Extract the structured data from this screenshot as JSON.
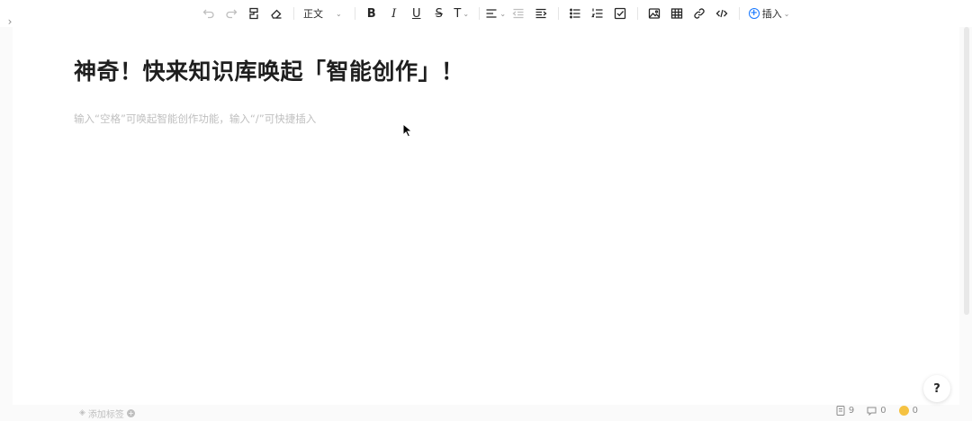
{
  "toolbar": {
    "style_label": "正文",
    "insert_label": "插入",
    "icons": [
      "undo-icon",
      "redo-icon",
      "format-painter-icon",
      "eraser-icon",
      "bold-icon",
      "italic-icon",
      "underline-icon",
      "strikethrough-icon",
      "font-size-icon",
      "align-icon",
      "outdent-icon",
      "indent-icon",
      "bullet-list-icon",
      "ordered-list-icon",
      "checklist-icon",
      "image-icon",
      "table-icon",
      "link-icon",
      "code-icon",
      "plus-circle-icon"
    ]
  },
  "editor": {
    "title": "神奇！快来知识库唤起「智能创作」！",
    "placeholder": "输入“空格”可唤起智能创作功能，输入“/”可快捷插入"
  },
  "footer": {
    "add_tag_label": "添加标签",
    "word_count": "9",
    "comment_count": "0",
    "coin_count": "0"
  },
  "help": {
    "label": "?"
  },
  "colors": {
    "accent": "#1677ff",
    "coin": "#f5c242",
    "placeholder": "#bfbfbf"
  }
}
